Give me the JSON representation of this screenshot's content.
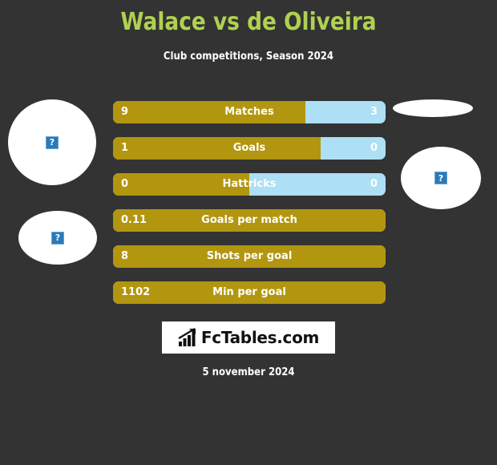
{
  "header": {
    "title": "Walace vs de Oliveira",
    "subtitle": "Club competitions, Season 2024"
  },
  "players": {
    "left": [
      {
        "name": "player-photo-left-top",
        "alt_icon": "broken-image-icon",
        "glyph": "?"
      },
      {
        "name": "player-photo-left-bottom",
        "alt_icon": "broken-image-icon",
        "glyph": "?"
      }
    ],
    "right": [
      {
        "name": "player-photo-right-top",
        "alt_icon": "broken-image-icon",
        "glyph": ""
      },
      {
        "name": "player-photo-right-bottom",
        "alt_icon": "broken-image-icon",
        "glyph": "?"
      }
    ]
  },
  "chart_data": {
    "type": "bar",
    "title": "Walace vs de Oliveira",
    "subtitle": "Club competitions, Season 2024",
    "orientation": "horizontal",
    "layout": "paired-opposing-bars",
    "legend": [
      "Walace",
      "de Oliveira"
    ],
    "colors": {
      "left_series": "#b2960f",
      "right_series": "#addff5",
      "background": "#333333",
      "title": "#b0d150",
      "text": "#ffffff"
    },
    "categories": [
      "Matches",
      "Goals",
      "Hattricks",
      "Goals per match",
      "Shots per goal",
      "Min per goal"
    ],
    "series": [
      {
        "name": "Walace",
        "values": [
          "9",
          "1",
          "0",
          "0.11",
          "8",
          "1102"
        ]
      },
      {
        "name": "de Oliveira",
        "values": [
          "3",
          "0",
          "0",
          "",
          "",
          ""
        ]
      }
    ],
    "fill_percent": [
      70.6,
      76.2,
      50.0,
      100,
      100,
      100
    ]
  },
  "stats": [
    {
      "label": "Matches",
      "left": "9",
      "right": "3",
      "fill": 70.6,
      "has_right": true
    },
    {
      "label": "Goals",
      "left": "1",
      "right": "0",
      "fill": 76.2,
      "has_right": true
    },
    {
      "label": "Hattricks",
      "left": "0",
      "right": "0",
      "fill": 50.0,
      "has_right": true
    },
    {
      "label": "Goals per match",
      "left": "0.11",
      "right": "",
      "fill": 100,
      "has_right": false
    },
    {
      "label": "Shots per goal",
      "left": "8",
      "right": "",
      "fill": 100,
      "has_right": false
    },
    {
      "label": "Min per goal",
      "left": "1102",
      "right": "",
      "fill": 100,
      "has_right": false
    }
  ],
  "logo": {
    "text": "FcTables.com",
    "icon": "bar-chart-trend-icon"
  },
  "footer": {
    "date": "5 november 2024"
  }
}
